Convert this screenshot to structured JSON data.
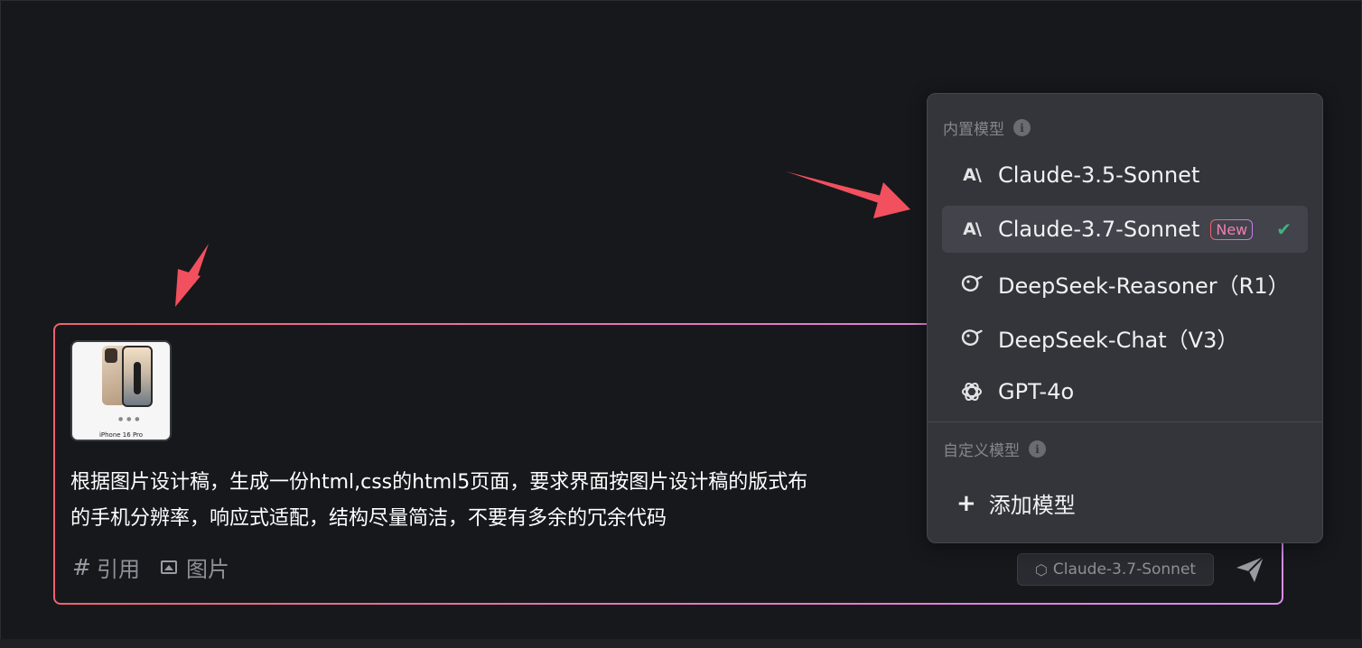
{
  "chat": {
    "attachment_caption": "iPhone 16 Pro",
    "prompt_text": "根据图片设计稿，生成一份html,css的html5页面，要求界面按图片设计稿的版式布",
    "prompt_text_line2": "的手机分辨率，响应式适配，结构尽量简洁，不要有多余的冗余代码",
    "tools": {
      "reference_symbol": "#",
      "reference_label": "引用",
      "image_label": "图片"
    },
    "selected_model_chip": "Claude-3.7-Sonnet"
  },
  "model_menu": {
    "builtin_title": "内置模型",
    "builtin_models": [
      {
        "label": "Claude-3.5-Sonnet",
        "icon": "anthropic-icon"
      },
      {
        "label": "Claude-3.7-Sonnet",
        "icon": "anthropic-icon",
        "badge": "New",
        "selected": true
      },
      {
        "label": "DeepSeek-Reasoner（R1）",
        "icon": "deepseek-icon"
      },
      {
        "label": "DeepSeek-Chat（V3）",
        "icon": "deepseek-icon"
      },
      {
        "label": "GPT-4o",
        "icon": "openai-icon"
      }
    ],
    "custom_title": "自定义模型",
    "add_model_label": "添加模型"
  },
  "colors": {
    "background": "#17181c",
    "menu_background": "#34353b",
    "selected_row": "#42434b",
    "check": "#3fb27f",
    "border_gradient_start": "#f0626b",
    "border_gradient_end": "#d88ef0",
    "annotation_arrow": "#f2505e"
  }
}
